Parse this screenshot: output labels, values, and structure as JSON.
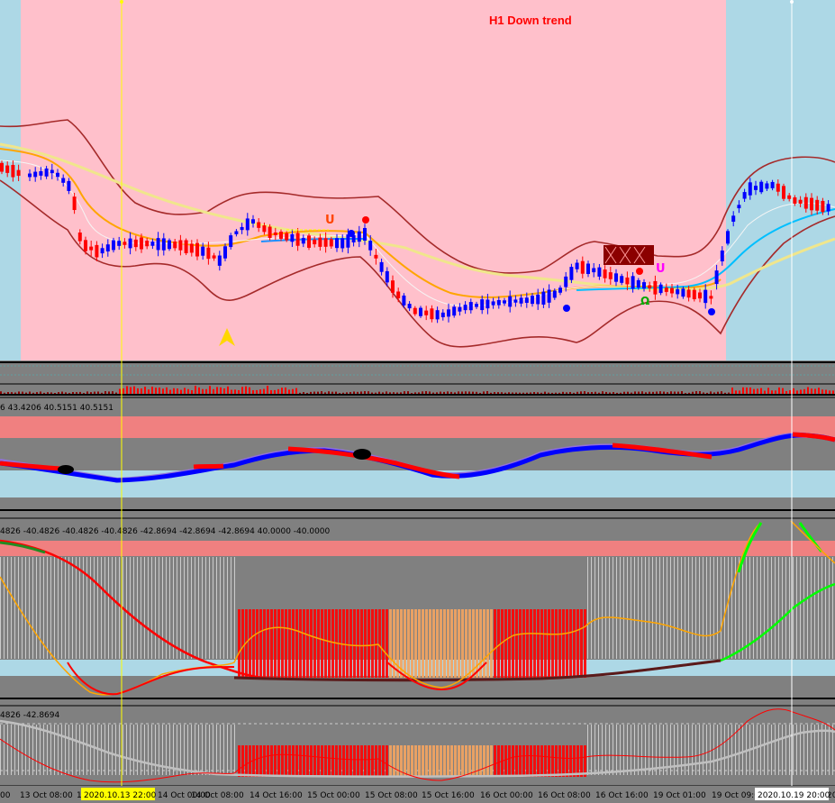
{
  "colors": {
    "down_zone": "#FFC0CB",
    "up_zone": "#ADD8E6",
    "panel_bg": "#808080",
    "bull_candle": "#0000FF",
    "bear_candle": "#FF0000",
    "bollinger": "#A52A2A",
    "trend_label": "#FF0000",
    "cursor_line": "#FFFF00",
    "time_label_bg": "#FFFF00",
    "time_label_bg2": "#FFFFFF"
  },
  "main": {
    "trend_label": "H1 Down trend"
  },
  "panels": {
    "p2_values": "6 43.4206 40.5151 40.5151",
    "p3_values": "4826 -40.4826 -40.4826 -40.4826 -42.8694 -42.8694 -42.8694 40.0000 -40.0000",
    "p4_values": "4826 -42.8694"
  },
  "time_axis": {
    "labels": [
      "00",
      "13 Oct 08:00",
      "13",
      "14 Oct 00:00",
      "14 Oct 08:00",
      "14 Oct 16:00",
      "15 Oct 00:00",
      "15 Oct 08:00",
      "15 Oct 16:00",
      "16 Oct 00:00",
      "16 Oct 08:00",
      "16 Oct 16:00",
      "19 Oct 01:00",
      "19 Oct 09:00",
      "20"
    ],
    "cursor_label_1": "2020.10.13 22:00",
    "cursor_label_2": "2020.10.19 20:00"
  }
}
